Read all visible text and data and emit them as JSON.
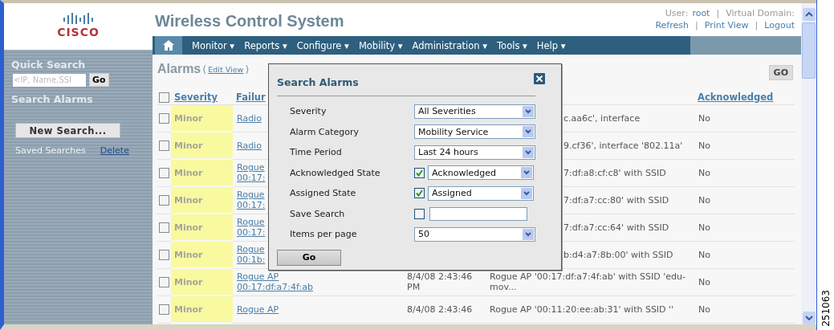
{
  "header": {
    "logo": "CISCO",
    "title": "Wireless Control System",
    "user_label": "User:",
    "user": "root",
    "domain_label": "Virtual Domain:",
    "separator": "|",
    "links": [
      "Refresh",
      "Print View",
      "Logout"
    ]
  },
  "nav": [
    "Monitor ▾",
    "Reports ▾",
    "Configure ▾",
    "Mobility ▾",
    "Administration ▾",
    "Tools ▾",
    "Help ▾"
  ],
  "sidebar": {
    "quick_search": "Quick Search",
    "search_placeholder": "<IP, Name,SSI",
    "go": "Go",
    "search_alarms": "Search Alarms",
    "new_search": "New Search...",
    "saved_searches": "Saved Searches",
    "delete": "Delete"
  },
  "page": {
    "title": "Alarms",
    "open_paren": "(",
    "edit_view": "Edit View",
    "close_paren": ")",
    "go": "GO"
  },
  "table": {
    "select_all_checked": false,
    "columns": [
      "Severity",
      "Failur",
      "Acknowledged"
    ],
    "rows": [
      {
        "kind": "partial",
        "checked": false,
        "severity": "Minor",
        "failure": [
          "Radio"
        ],
        "message": "c.aa6c', interface",
        "acknowledged": "No"
      },
      {
        "kind": "partial",
        "checked": false,
        "severity": "Minor",
        "failure": [
          "Radio"
        ],
        "message": "9.cf36', interface '802.11a'",
        "acknowledged": "No"
      },
      {
        "kind": "partial",
        "checked": false,
        "severity": "Minor",
        "failure": [
          "Rogue",
          "00:17:"
        ],
        "message": "7:df:a8:cf:c8' with SSID",
        "acknowledged": "No"
      },
      {
        "kind": "partial",
        "checked": false,
        "severity": "Minor",
        "failure": [
          "Rogue",
          "00:17:"
        ],
        "message": "7:df:a7:cc:80' with SSID",
        "acknowledged": "No"
      },
      {
        "kind": "partial",
        "checked": false,
        "severity": "Minor",
        "failure": [
          "Rogue",
          "00:17:"
        ],
        "message": "7:df:a7:cc:64' with SSID",
        "acknowledged": "No"
      },
      {
        "kind": "partial",
        "checked": false,
        "severity": "Minor",
        "failure": [
          "Rogue",
          "00:1b:"
        ],
        "message": "b:d4:a7:8b:00' with SSID",
        "acknowledged": "No"
      },
      {
        "kind": "full",
        "checked": false,
        "severity": "Minor",
        "failure": [
          "Rogue AP",
          "00:17:df:a7:4f:ab"
        ],
        "date": "8/4/08 2:43:46 PM",
        "message": "Rogue AP '00:17:df:a7:4f:ab' with SSID 'edu-mov...",
        "acknowledged": "No"
      },
      {
        "kind": "full",
        "checked": false,
        "severity": "Minor",
        "failure": [
          "Rogue AP"
        ],
        "date": "8/4/08 2:43:46",
        "message": "Rogue AP '00:11:20:ee:ab:31' with SSID ''",
        "acknowledged": "No"
      }
    ]
  },
  "dialog": {
    "title": "Search Alarms",
    "fields": [
      {
        "kind": "select",
        "label": "Severity",
        "value": "All Severities"
      },
      {
        "kind": "select",
        "label": "Alarm Category",
        "value": "Mobility Service"
      },
      {
        "kind": "select",
        "label": "Time Period",
        "value": "Last 24 hours"
      },
      {
        "kind": "check-select",
        "label": "Acknowledged State",
        "checked": true,
        "value": "Acknowledged"
      },
      {
        "kind": "check-select",
        "label": "Assigned State",
        "checked": true,
        "value": "Assigned"
      },
      {
        "kind": "check-input",
        "label": "Save Search",
        "checked": false
      },
      {
        "kind": "select",
        "label": "Items per page",
        "value": "50"
      }
    ],
    "go": "Go"
  },
  "figure_number": "251063"
}
